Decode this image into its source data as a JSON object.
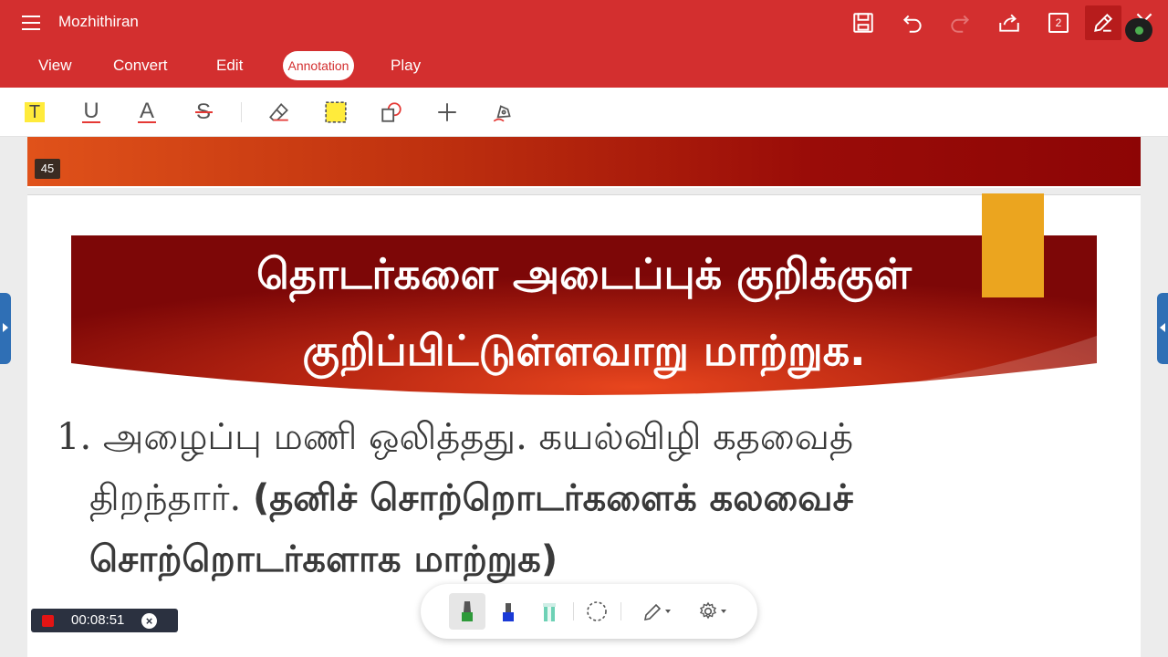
{
  "app": {
    "title": "Mozhithiran"
  },
  "header": {
    "page_count": "2",
    "icons": [
      "menu-icon",
      "save-icon",
      "undo-icon",
      "redo-icon",
      "share-icon",
      "page-count-icon",
      "edit-pen-icon",
      "close-icon"
    ]
  },
  "tabs": [
    {
      "label": "View"
    },
    {
      "label": "Convert"
    },
    {
      "label": "Edit"
    },
    {
      "label": "Annotation",
      "active": true
    },
    {
      "label": "Play"
    }
  ],
  "annotation_tools": {
    "highlight_text": "T",
    "underline_text": "U",
    "text_color": "A",
    "strikethrough_text": "S",
    "icons": [
      "eraser-icon",
      "area-highlight-icon",
      "shape-icon",
      "add-icon",
      "signature-pen-icon"
    ]
  },
  "document": {
    "page_number": "45",
    "banner": {
      "line1": "தொடர்களை அடைப்புக் குறிக்குள்",
      "line2": "குறிப்பிட்டுள்ளவாறு மாற்றுக."
    },
    "question": {
      "number": "1.",
      "line1": "அழைப்பு மணி ஒலித்தது. கயல்விழி கதவைத்",
      "line2_plain": "திறந்தார். ",
      "line2_bold": "(தனிச் சொற்றொடர்களைக் கலவைச்",
      "line3_bold": "சொற்றொடர்களாக மாற்றுக)"
    },
    "colors": {
      "accent": "#d32f2f",
      "banner_dark": "#8d0505",
      "banner_light": "#e0521a",
      "tab_yellow": "#eba51f"
    }
  },
  "recorder": {
    "time": "00:08:51",
    "close_label": "×"
  },
  "pen_toolbar": {
    "icons": [
      "green-marker-icon",
      "blue-marker-icon",
      "highlighter-icon",
      "lasso-icon",
      "pen-dropdown-icon",
      "settings-dropdown-icon"
    ]
  }
}
